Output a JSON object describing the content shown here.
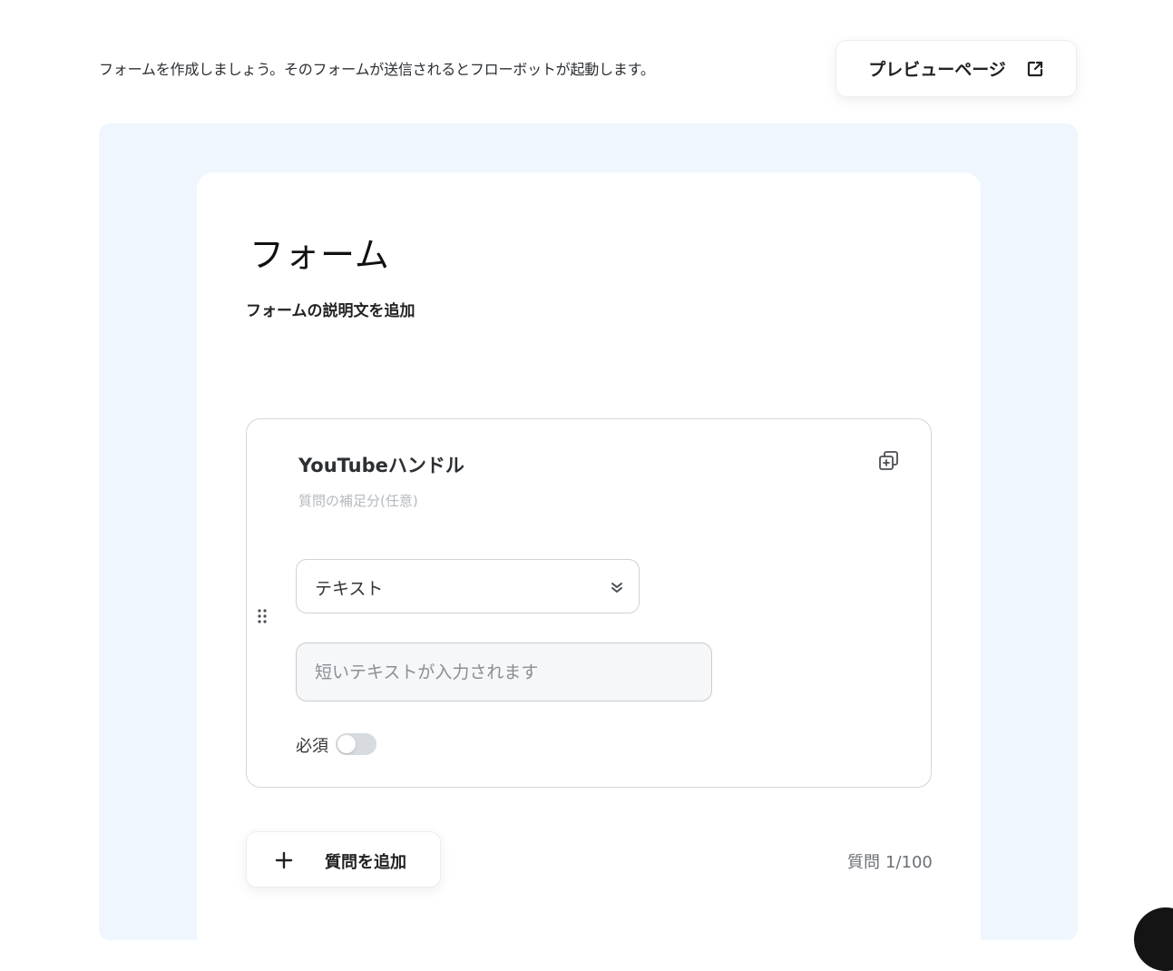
{
  "header": {
    "intro_text": "フォームを作成しましょう。そのフォームが送信されるとフローボットが起動します。",
    "preview_label": "プレビューページ",
    "preview_icon": "external-link-icon"
  },
  "form": {
    "title": "フォーム",
    "description_placeholder": "フォームの説明文を追加"
  },
  "question": {
    "title": "YouTubeハンドル",
    "supplement_placeholder": "質問の補足分(任意)",
    "type_value": "テキスト",
    "answer_placeholder": "短いテキストが入力されます",
    "required_label": "必須",
    "required": false,
    "duplicate_icon": "duplicate-icon",
    "drag_icon": "drag-handle-icon",
    "select_icon": "chevron-double-down-icon"
  },
  "footer": {
    "add_question_label": "質問を追加",
    "add_icon": "plus-icon",
    "count_label": "質問",
    "count_value": "1/100"
  },
  "colors": {
    "canvas_bg": "#eff6fe",
    "card_bg": "#ffffff",
    "toggle_off": "#d7dbe0"
  }
}
